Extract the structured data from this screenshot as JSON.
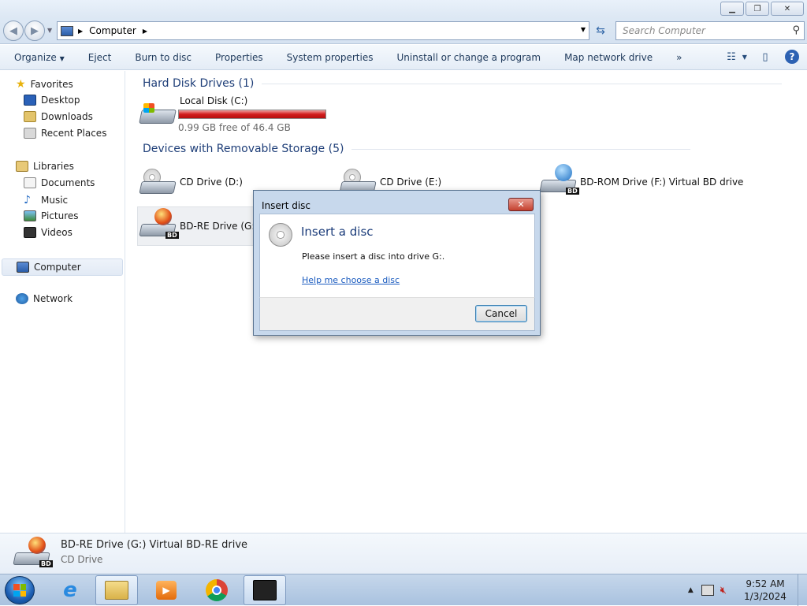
{
  "window": {
    "minimize_icon": "minimize-icon",
    "maximize_icon": "restore-icon",
    "close_icon": "close-icon"
  },
  "address": {
    "location": "Computer",
    "search_placeholder": "Search Computer"
  },
  "toolbar": {
    "items": [
      "Organize",
      "Eject",
      "Burn to disc",
      "Properties",
      "System properties",
      "Uninstall or change a program",
      "Map network drive"
    ],
    "organize_arrow": "▼",
    "more": "»"
  },
  "sidebar": {
    "favorites": "Favorites",
    "desktop": "Desktop",
    "downloads": "Downloads",
    "recent": "Recent Places",
    "libraries": "Libraries",
    "documents": "Documents",
    "music": "Music",
    "pictures": "Pictures",
    "videos": "Videos",
    "computer": "Computer",
    "network": "Network"
  },
  "groups": {
    "hdd_title": "Hard Disk Drives (1)",
    "removable_title": "Devices with Removable Storage (5)"
  },
  "drives": {
    "c_name": "Local Disk (C:)",
    "c_free": "0.99 GB free of 46.4 GB",
    "c_used_fraction": 0.979,
    "d_name": "CD Drive (D:)",
    "e_name": "CD Drive (E:)",
    "f_name": "BD-ROM Drive (F:) Virtual BD drive",
    "g_name": "BD-RE Drive (G:)",
    "bd_tag": "BD"
  },
  "details": {
    "name": "BD-RE Drive (G:) Virtual BD-RE drive",
    "type": "CD Drive",
    "bd_tag": "BD"
  },
  "dialog": {
    "title": "Insert disc",
    "close": "✕",
    "heading": "Insert a disc",
    "message": "Please insert a disc into drive G:.",
    "link": "Help me choose a disc",
    "cancel": "Cancel"
  },
  "taskbar": {
    "time": "9:52 AM",
    "date": "1/3/2024",
    "apps": [
      "internet-explorer",
      "file-explorer",
      "media-player",
      "chrome",
      "video-editor"
    ]
  },
  "colors": {
    "hdd_bar": "#d21c1c",
    "group_header": "#1e3e78",
    "link": "#1a5bbf"
  }
}
